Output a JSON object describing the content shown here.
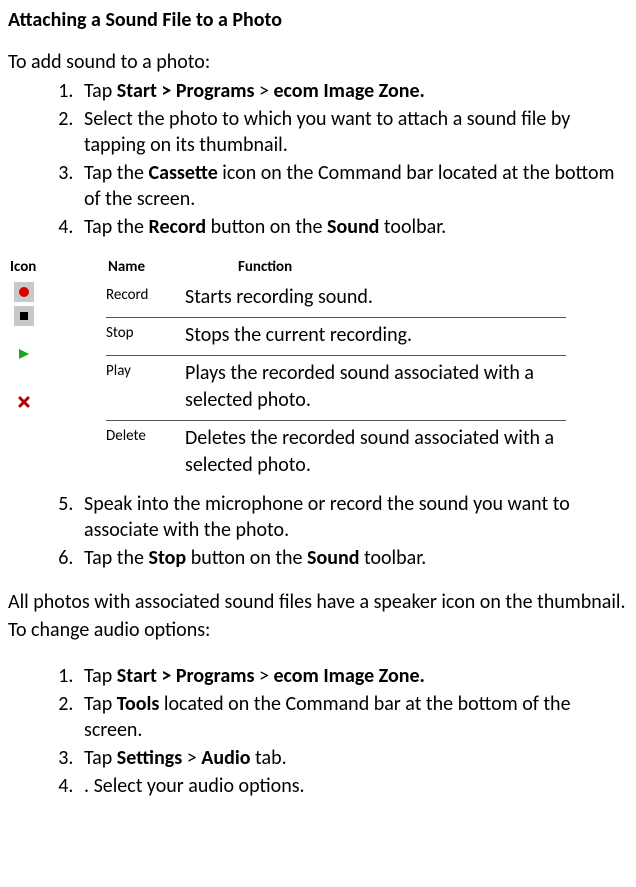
{
  "heading": "Attaching a Sound File to a Photo",
  "intro_add": "To add sound to a photo:",
  "steps_add": {
    "s1_a": "Tap ",
    "s1_b": "Start > Programs",
    "s1_c": " > ",
    "s1_d": "ecom Image Zone.",
    "s2": "Select the photo to which you want to attach a sound file by tapping on its thumbnail.",
    "s3_a": "Tap the ",
    "s3_b": "Cassette",
    "s3_c": " icon on the Command bar located at the bottom of the screen.",
    "s4_a": "Tap the ",
    "s4_b": "Record",
    "s4_c": " button on the ",
    "s4_d": "Sound",
    "s4_e": " toolbar.",
    "s5": "Speak into the microphone or record the sound you want to associate with the photo.",
    "s6_a": "Tap the ",
    "s6_b": "Stop",
    "s6_c": " button on the ",
    "s6_d": "Sound",
    "s6_e": " toolbar."
  },
  "table": {
    "header_icon": "Icon",
    "header_name": "Name",
    "header_func": "Function",
    "rows": [
      {
        "name": "Record",
        "func": "Starts recording sound."
      },
      {
        "name": "Stop",
        "func": "Stops the current recording."
      },
      {
        "name": "Play",
        "func": "Plays the recorded sound associated with a selected photo."
      },
      {
        "name": "Delete",
        "func": "Deletes the recorded sound associated with a selected photo."
      }
    ]
  },
  "para_speaker": "All photos with associated sound files have a speaker icon on the thumbnail.",
  "intro_change": "To change audio options:",
  "steps_change": {
    "s1_a": "Tap ",
    "s1_b": "Start > Programs",
    "s1_c": " > ",
    "s1_d": "ecom Image Zone.",
    "s2_a": "Tap ",
    "s2_b": "Tools",
    "s2_c": " located on the Command bar at the bottom of the screen.",
    "s3_a": "Tap ",
    "s3_b": "Settings",
    "s3_c": " > ",
    "s3_d": "Audio",
    "s3_e": " tab.",
    "s4": ". Select your audio options."
  }
}
